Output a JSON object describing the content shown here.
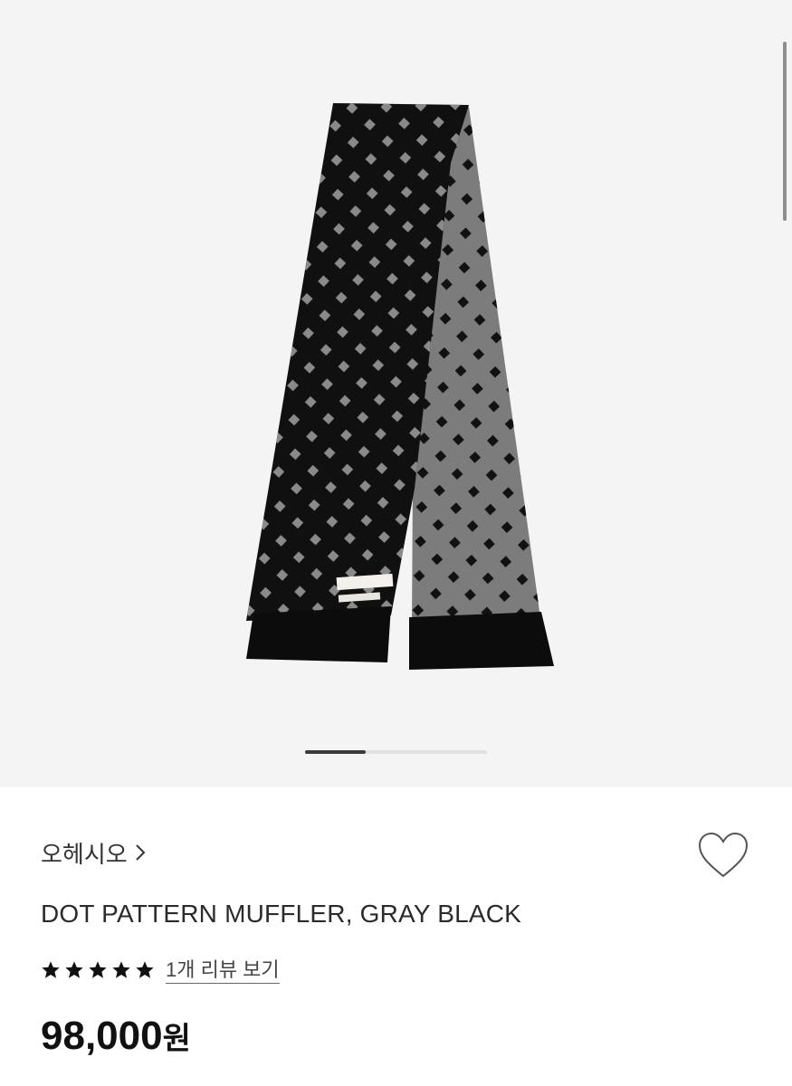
{
  "product": {
    "image_icon": "scarf-product-image",
    "gallery": {
      "active_index": 1,
      "total": 3
    }
  },
  "brand": {
    "name": "오헤시오",
    "chevron_icon": "chevron-right-icon"
  },
  "wishlist": {
    "icon": "heart-outline-icon"
  },
  "title": "DOT PATTERN MUFFLER, GRAY BLACK",
  "rating": {
    "stars": 5,
    "max": 5,
    "review_link": "1개 리뷰 보기"
  },
  "price": {
    "value": "98,000",
    "unit": "원"
  }
}
